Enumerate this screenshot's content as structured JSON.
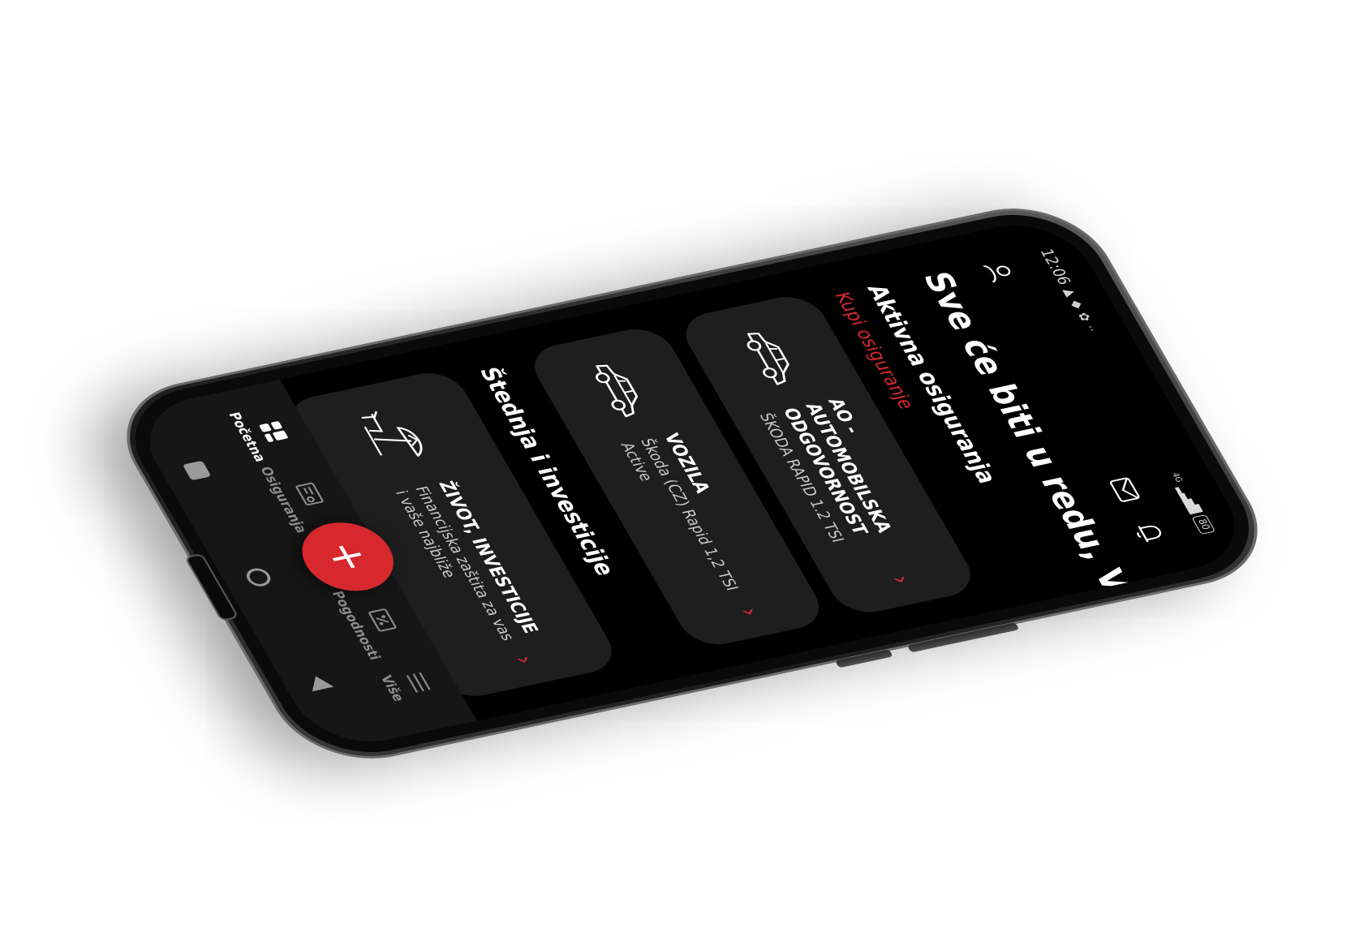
{
  "status_bar": {
    "time": "12:06",
    "network": "4G",
    "battery": "80"
  },
  "header": {
    "greeting": "Sve će biti u redu, Vitomir"
  },
  "active_section": {
    "title": "Aktivna osiguranja",
    "buy_link": "Kupi osiguranje",
    "cards": [
      {
        "title": "AO - AUTOMOBILSKA ODGOVORNOST",
        "subtitle": "ŠKODA RAPID 1.2 TSI",
        "icon": "car-icon"
      },
      {
        "title": "VOZILA",
        "subtitle": "Škoda (CZ) Rapid 1,2 TSI Active",
        "icon": "car-icon"
      }
    ]
  },
  "savings_section": {
    "title": "Štednja i investicije",
    "cards": [
      {
        "title": "ŽIVOT, INVESTICIJE",
        "subtitle": "Financijska zaštita za vas i vaše najbliže",
        "icon": "beach-umbrella-icon"
      }
    ]
  },
  "bottom_nav": {
    "items": [
      {
        "label": "Početna",
        "icon": "dashboard-icon",
        "active": true
      },
      {
        "label": "Osiguranja",
        "icon": "policy-icon",
        "active": false
      },
      {
        "label": "Pogodnosti",
        "icon": "discount-icon",
        "active": false
      },
      {
        "label": "Više",
        "icon": "menu-icon",
        "active": false
      }
    ],
    "fab_label": "+"
  },
  "colors": {
    "accent": "#d6282d",
    "background": "#000000",
    "card": "#1e1e1e"
  }
}
